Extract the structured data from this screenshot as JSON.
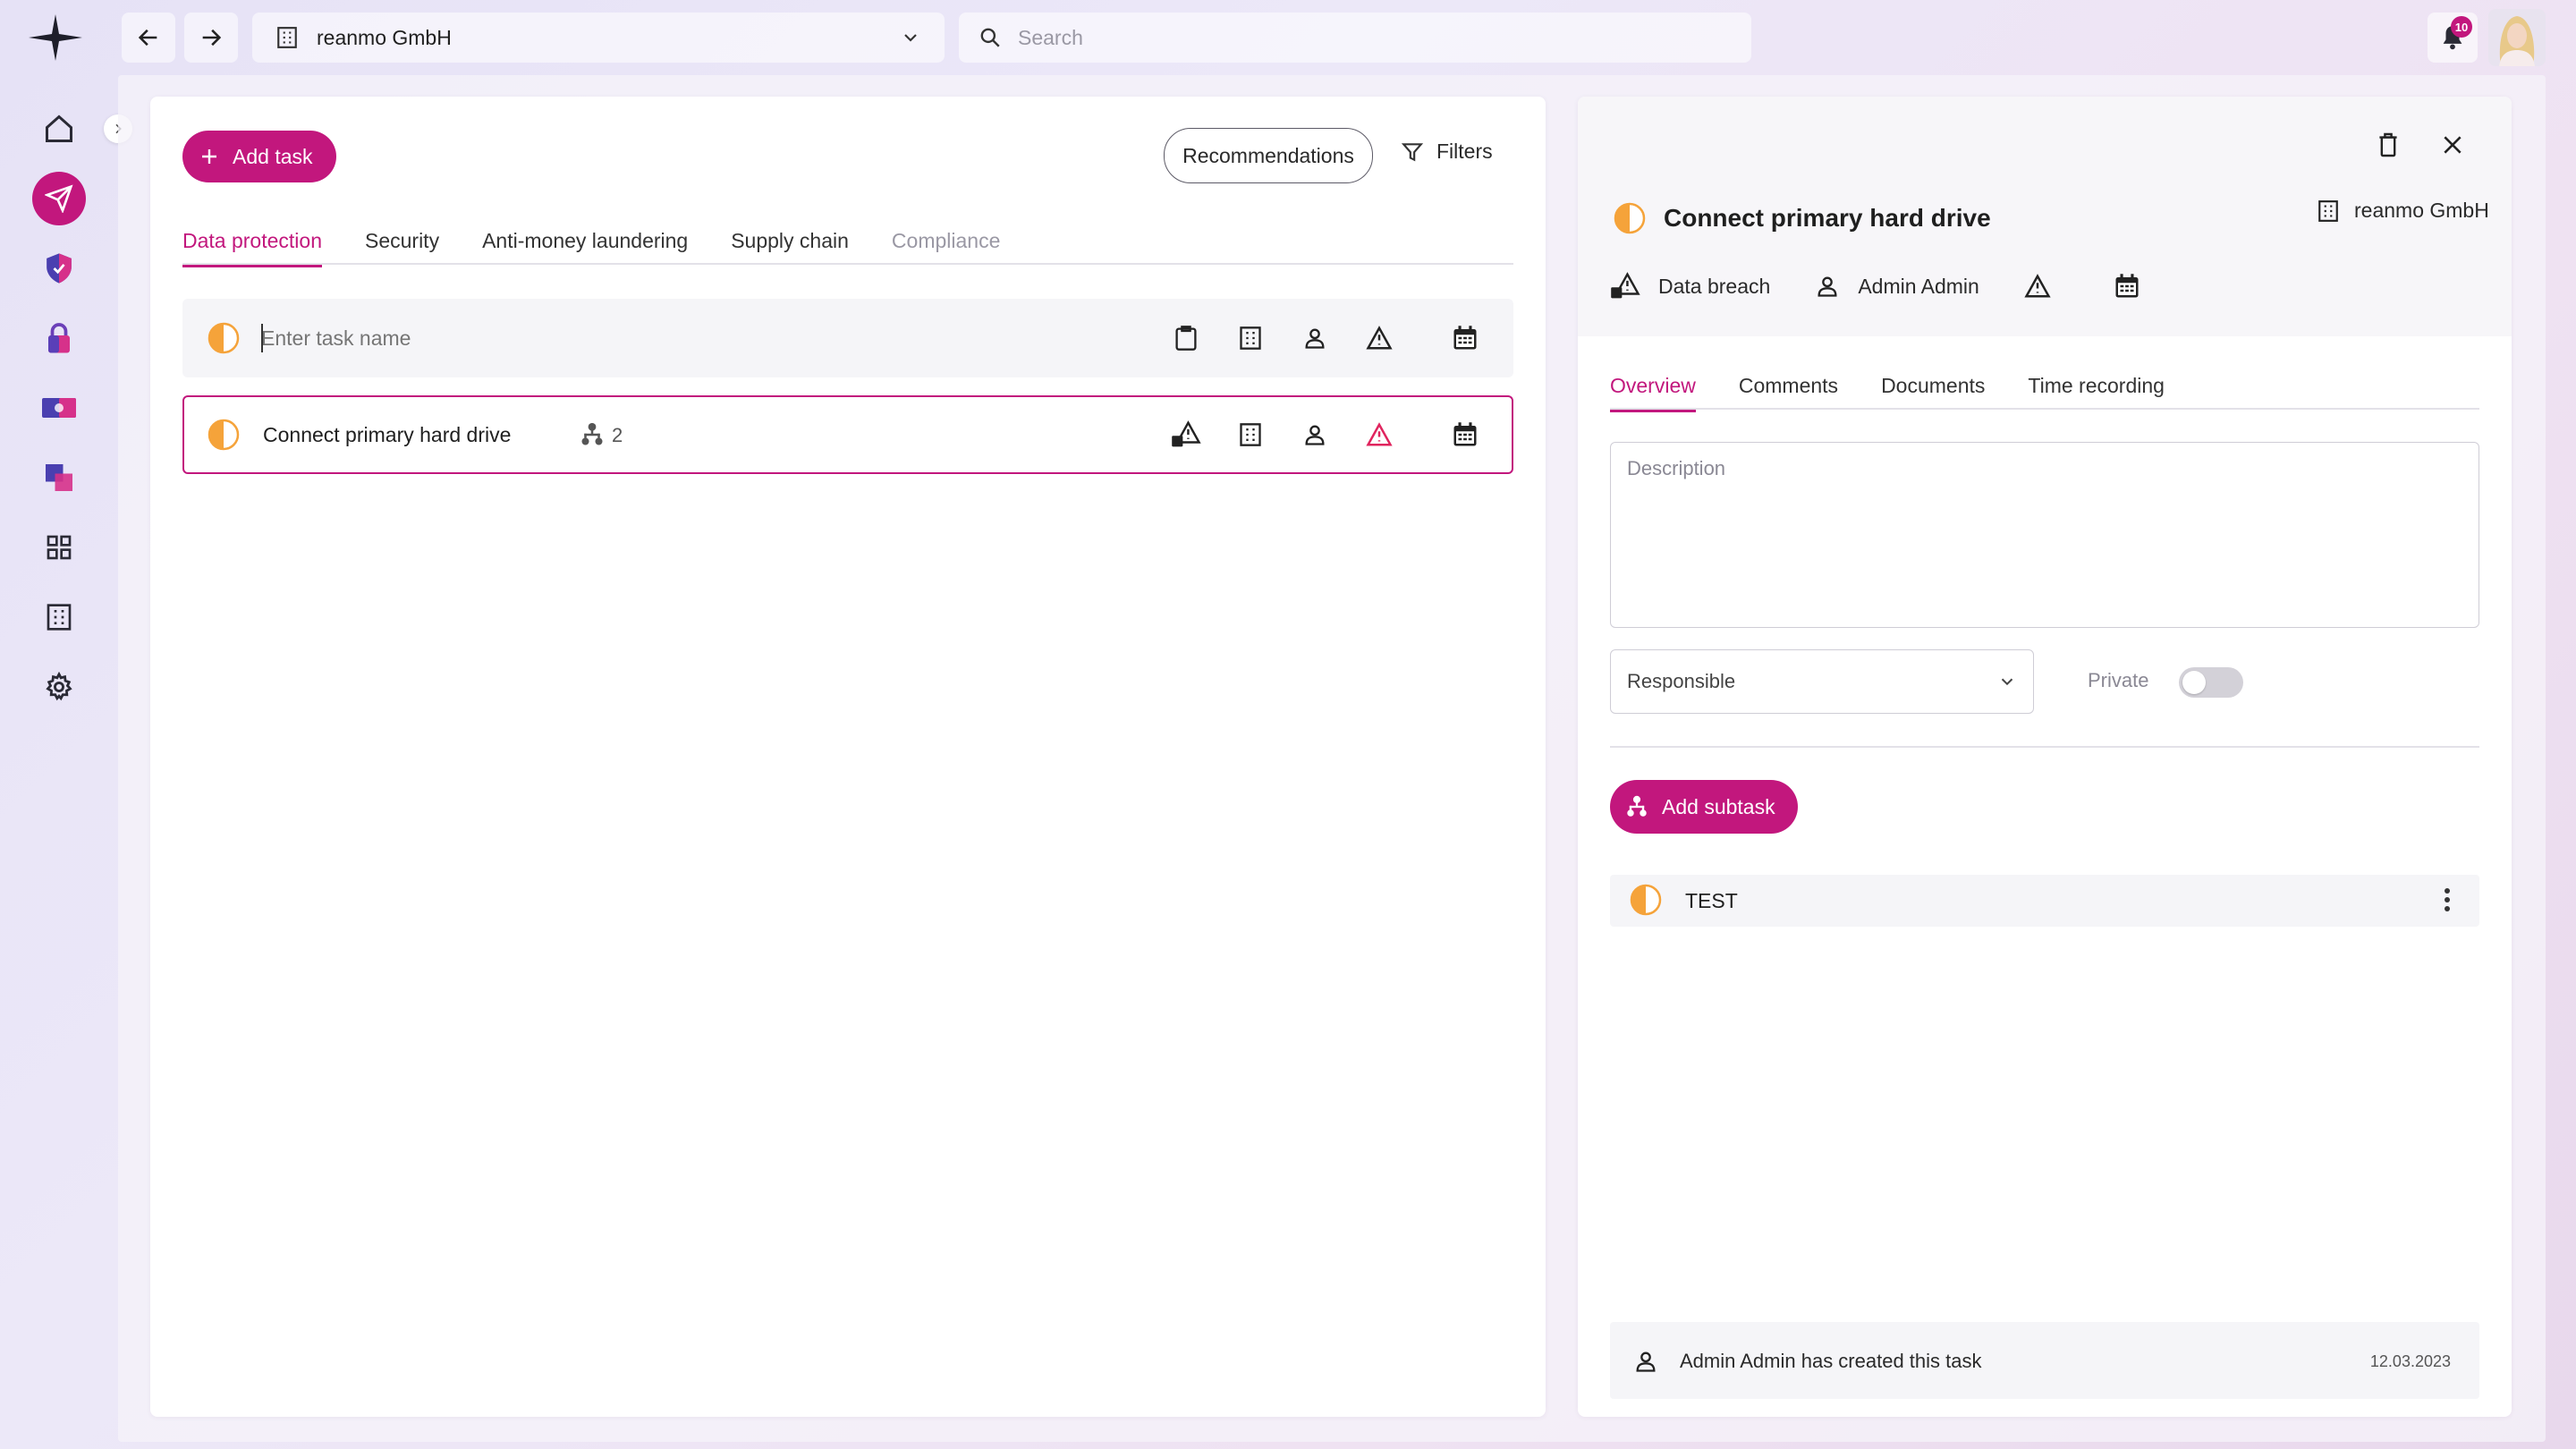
{
  "colors": {
    "accent": "#c2177d",
    "status_half": "#f5a33a",
    "warning_red": "#e0245e"
  },
  "header": {
    "org_name": "reanmo GmbH",
    "search_placeholder": "Search",
    "notification_count": "10"
  },
  "toolbar": {
    "add_task_label": "Add task",
    "recommendations_label": "Recommendations",
    "filters_label": "Filters"
  },
  "tabs": [
    {
      "label": "Data protection",
      "state": "active"
    },
    {
      "label": "Security",
      "state": "normal"
    },
    {
      "label": "Anti-money laundering",
      "state": "normal"
    },
    {
      "label": "Supply chain",
      "state": "normal"
    },
    {
      "label": "Compliance",
      "state": "disabled"
    }
  ],
  "new_task": {
    "placeholder": "Enter task name"
  },
  "tasks": [
    {
      "name": "Connect primary hard drive",
      "subtask_count": "2"
    }
  ],
  "detail": {
    "title": "Connect primary hard drive",
    "org": "reanmo GmbH",
    "category": "Data breach",
    "assignee": "Admin Admin",
    "tabs": [
      {
        "label": "Overview",
        "state": "active"
      },
      {
        "label": "Comments",
        "state": "normal"
      },
      {
        "label": "Documents",
        "state": "normal"
      },
      {
        "label": "Time recording",
        "state": "normal"
      }
    ],
    "description_placeholder": "Description",
    "responsible_label": "Responsible",
    "private_label": "Private",
    "private_on": false,
    "add_subtask_label": "Add subtask",
    "subtasks": [
      {
        "name": "TEST"
      }
    ],
    "activity": {
      "text": "Admin Admin has created this task",
      "date": "12.03.2023"
    }
  }
}
